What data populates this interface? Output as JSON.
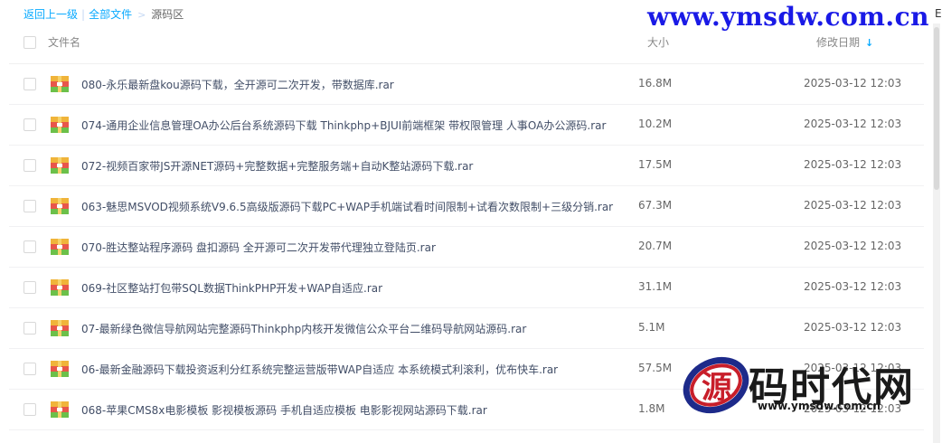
{
  "breadcrumb": {
    "back": "返回上一级",
    "separator": "|",
    "all_files": "全部文件",
    "arrow": ">",
    "current": "源码区"
  },
  "watermark": {
    "url": "www.ymsdw.com.cn",
    "logo_text": "码时代网",
    "logo_glyph": "源",
    "logo_url": "www.ymsdw.com.cn"
  },
  "corner_char": "E",
  "header": {
    "name": "文件名",
    "size": "大小",
    "date": "修改日期",
    "sort_icon": "arrow-down-icon"
  },
  "icon_colors": {
    "link": "#09aaff",
    "checkbox_border": "#d8d8d8"
  },
  "files": [
    {
      "name": "080-永乐最新盘kou源码下载，全开源可二次开发，带数据库.rar",
      "size": "16.8M",
      "date": "2025-03-12 12:03"
    },
    {
      "name": "074-通用企业信息管理OA办公后台系统源码下载 Thinkphp+BJUI前端框架 带权限管理 人事OA办公源码.rar",
      "size": "10.2M",
      "date": "2025-03-12 12:03"
    },
    {
      "name": "072-视频百家带JS开源NET源码+完整数据+完整服务端+自动K整站源码下载.rar",
      "size": "17.5M",
      "date": "2025-03-12 12:03"
    },
    {
      "name": "063-魅思MSVOD视频系统V9.6.5高级版源码下载PC+WAP手机端试看时间限制+试看次数限制+三级分销.rar",
      "size": "67.3M",
      "date": "2025-03-12 12:03"
    },
    {
      "name": "070-胜达整站程序源码 盘扣源码 全开源可二次开发带代理独立登陆页.rar",
      "size": "20.7M",
      "date": "2025-03-12 12:03"
    },
    {
      "name": "069-社区整站打包带SQL数据ThinkPHP开发+WAP自适应.rar",
      "size": "31.1M",
      "date": "2025-03-12 12:03"
    },
    {
      "name": "07-最新绿色微信导航网站完整源码Thinkphp内核开发微信公众平台二维码导航网站源码.rar",
      "size": "5.1M",
      "date": "2025-03-12 12:03"
    },
    {
      "name": "06-最新金融源码下载投资返利分红系统完整运营版带WAP自适应 本系统模式利滚利，优布快车.rar",
      "size": "57.5M",
      "date": "2025-03-12 12:03"
    },
    {
      "name": "068-苹果CMS8x电影模板 影视模板源码 手机自适应模板 电影影视网站源码下载.rar",
      "size": "1.8M",
      "date": "2025-03-12 12:03"
    }
  ]
}
